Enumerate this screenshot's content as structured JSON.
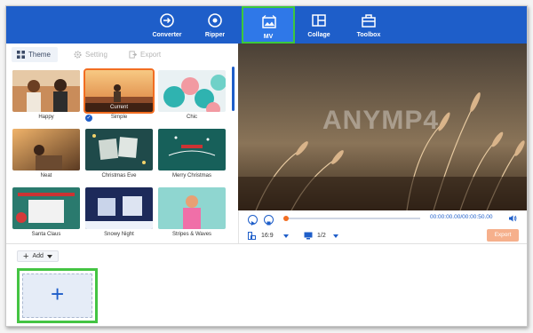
{
  "nav": [
    {
      "label": "Converter",
      "icon": "converter-icon"
    },
    {
      "label": "Ripper",
      "icon": "ripper-icon"
    },
    {
      "label": "MV",
      "icon": "mv-icon",
      "active": true
    },
    {
      "label": "Collage",
      "icon": "collage-icon"
    },
    {
      "label": "Toolbox",
      "icon": "toolbox-icon"
    }
  ],
  "tabs": [
    {
      "label": "Theme",
      "icon": "grid-icon",
      "active": true
    },
    {
      "label": "Setting",
      "icon": "gear-icon"
    },
    {
      "label": "Export",
      "icon": "export-icon"
    }
  ],
  "themes": [
    {
      "label": "Happy"
    },
    {
      "label": "Simple",
      "selected": true,
      "tag": "Current"
    },
    {
      "label": "Chic"
    },
    {
      "label": "Neat"
    },
    {
      "label": "Christmas Eve"
    },
    {
      "label": "Merry Christmas"
    },
    {
      "label": "Santa Claus"
    },
    {
      "label": "Snowy Night"
    },
    {
      "label": "Stripes & Waves"
    }
  ],
  "preview": {
    "watermark": "ANYMP4",
    "time": "00:00:00.00/00:00:50.00",
    "aspect": "16:9",
    "page": "1/2",
    "export_label": "Export",
    "progress": 0
  },
  "timeline": {
    "add_label": "Add"
  },
  "colors": {
    "primary": "#1e5ec9",
    "accent": "#f26d21",
    "highlight": "#44c443"
  }
}
